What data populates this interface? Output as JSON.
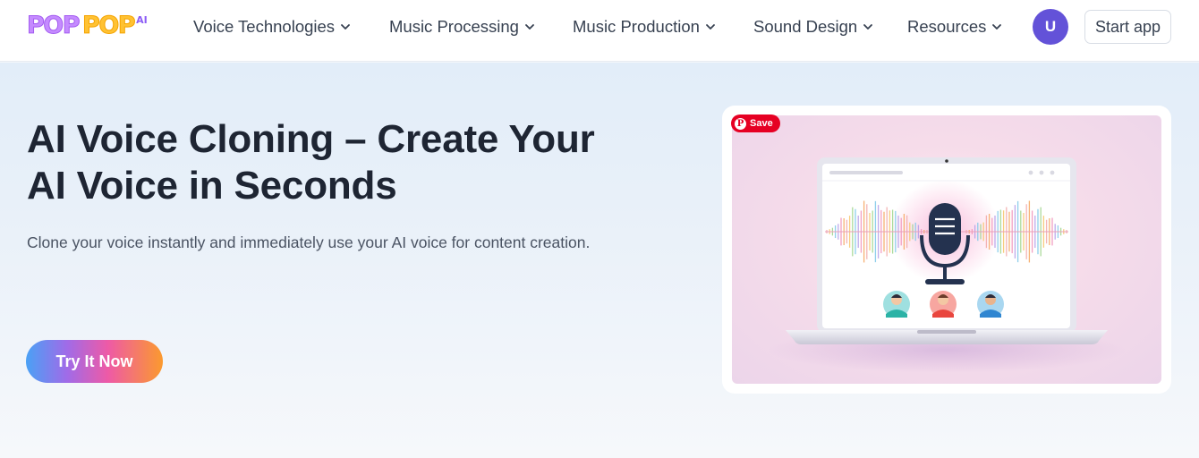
{
  "logo": {
    "word1": "POP",
    "word2": "POP",
    "suffix": "AI"
  },
  "nav": {
    "items": [
      {
        "label": "Voice Technologies"
      },
      {
        "label": "Music Processing"
      },
      {
        "label": "Music Production"
      },
      {
        "label": "Sound Design"
      },
      {
        "label": "Resources"
      }
    ]
  },
  "user": {
    "avatar_initial": "U"
  },
  "header_actions": {
    "start_label": "Start app"
  },
  "hero": {
    "title_line1": "AI Voice Cloning – Create Your",
    "title_line2": "AI Voice in Seconds",
    "subtitle": "Clone your voice instantly and immediately use your AI voice for content creation.",
    "cta_label": "Try It Now"
  },
  "image_card": {
    "save_label": "Save",
    "pin_glyph": "P"
  },
  "colors": {
    "accent": "#6352d8",
    "pinterest": "#e60023",
    "cta_gradient": [
      "#4aa1f5",
      "#a06be8",
      "#ee5aa6",
      "#fb9a2e"
    ]
  },
  "icons": [
    "chevron-down-icon",
    "pinterest-icon",
    "microphone-icon",
    "sound-wave-icon",
    "laptop-icon",
    "person-avatar-icon"
  ]
}
